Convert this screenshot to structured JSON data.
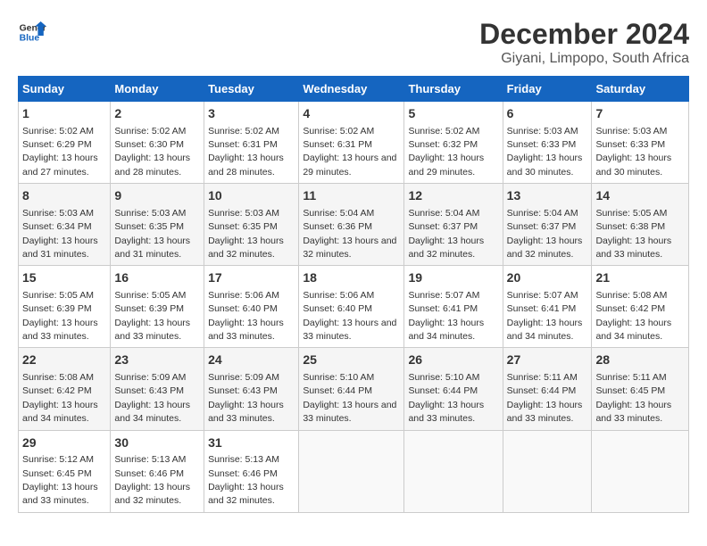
{
  "logo": {
    "line1": "General",
    "line2": "Blue"
  },
  "title": "December 2024",
  "subtitle": "Giyani, Limpopo, South Africa",
  "days_of_week": [
    "Sunday",
    "Monday",
    "Tuesday",
    "Wednesday",
    "Thursday",
    "Friday",
    "Saturday"
  ],
  "weeks": [
    [
      {
        "day": 1,
        "sunrise": "5:02 AM",
        "sunset": "6:29 PM",
        "daylight": "13 hours and 27 minutes."
      },
      {
        "day": 2,
        "sunrise": "5:02 AM",
        "sunset": "6:30 PM",
        "daylight": "13 hours and 28 minutes."
      },
      {
        "day": 3,
        "sunrise": "5:02 AM",
        "sunset": "6:31 PM",
        "daylight": "13 hours and 28 minutes."
      },
      {
        "day": 4,
        "sunrise": "5:02 AM",
        "sunset": "6:31 PM",
        "daylight": "13 hours and 29 minutes."
      },
      {
        "day": 5,
        "sunrise": "5:02 AM",
        "sunset": "6:32 PM",
        "daylight": "13 hours and 29 minutes."
      },
      {
        "day": 6,
        "sunrise": "5:03 AM",
        "sunset": "6:33 PM",
        "daylight": "13 hours and 30 minutes."
      },
      {
        "day": 7,
        "sunrise": "5:03 AM",
        "sunset": "6:33 PM",
        "daylight": "13 hours and 30 minutes."
      }
    ],
    [
      {
        "day": 8,
        "sunrise": "5:03 AM",
        "sunset": "6:34 PM",
        "daylight": "13 hours and 31 minutes."
      },
      {
        "day": 9,
        "sunrise": "5:03 AM",
        "sunset": "6:35 PM",
        "daylight": "13 hours and 31 minutes."
      },
      {
        "day": 10,
        "sunrise": "5:03 AM",
        "sunset": "6:35 PM",
        "daylight": "13 hours and 32 minutes."
      },
      {
        "day": 11,
        "sunrise": "5:04 AM",
        "sunset": "6:36 PM",
        "daylight": "13 hours and 32 minutes."
      },
      {
        "day": 12,
        "sunrise": "5:04 AM",
        "sunset": "6:37 PM",
        "daylight": "13 hours and 32 minutes."
      },
      {
        "day": 13,
        "sunrise": "5:04 AM",
        "sunset": "6:37 PM",
        "daylight": "13 hours and 32 minutes."
      },
      {
        "day": 14,
        "sunrise": "5:05 AM",
        "sunset": "6:38 PM",
        "daylight": "13 hours and 33 minutes."
      }
    ],
    [
      {
        "day": 15,
        "sunrise": "5:05 AM",
        "sunset": "6:39 PM",
        "daylight": "13 hours and 33 minutes."
      },
      {
        "day": 16,
        "sunrise": "5:05 AM",
        "sunset": "6:39 PM",
        "daylight": "13 hours and 33 minutes."
      },
      {
        "day": 17,
        "sunrise": "5:06 AM",
        "sunset": "6:40 PM",
        "daylight": "13 hours and 33 minutes."
      },
      {
        "day": 18,
        "sunrise": "5:06 AM",
        "sunset": "6:40 PM",
        "daylight": "13 hours and 33 minutes."
      },
      {
        "day": 19,
        "sunrise": "5:07 AM",
        "sunset": "6:41 PM",
        "daylight": "13 hours and 34 minutes."
      },
      {
        "day": 20,
        "sunrise": "5:07 AM",
        "sunset": "6:41 PM",
        "daylight": "13 hours and 34 minutes."
      },
      {
        "day": 21,
        "sunrise": "5:08 AM",
        "sunset": "6:42 PM",
        "daylight": "13 hours and 34 minutes."
      }
    ],
    [
      {
        "day": 22,
        "sunrise": "5:08 AM",
        "sunset": "6:42 PM",
        "daylight": "13 hours and 34 minutes."
      },
      {
        "day": 23,
        "sunrise": "5:09 AM",
        "sunset": "6:43 PM",
        "daylight": "13 hours and 34 minutes."
      },
      {
        "day": 24,
        "sunrise": "5:09 AM",
        "sunset": "6:43 PM",
        "daylight": "13 hours and 33 minutes."
      },
      {
        "day": 25,
        "sunrise": "5:10 AM",
        "sunset": "6:44 PM",
        "daylight": "13 hours and 33 minutes."
      },
      {
        "day": 26,
        "sunrise": "5:10 AM",
        "sunset": "6:44 PM",
        "daylight": "13 hours and 33 minutes."
      },
      {
        "day": 27,
        "sunrise": "5:11 AM",
        "sunset": "6:44 PM",
        "daylight": "13 hours and 33 minutes."
      },
      {
        "day": 28,
        "sunrise": "5:11 AM",
        "sunset": "6:45 PM",
        "daylight": "13 hours and 33 minutes."
      }
    ],
    [
      {
        "day": 29,
        "sunrise": "5:12 AM",
        "sunset": "6:45 PM",
        "daylight": "13 hours and 33 minutes."
      },
      {
        "day": 30,
        "sunrise": "5:13 AM",
        "sunset": "6:46 PM",
        "daylight": "13 hours and 32 minutes."
      },
      {
        "day": 31,
        "sunrise": "5:13 AM",
        "sunset": "6:46 PM",
        "daylight": "13 hours and 32 minutes."
      },
      null,
      null,
      null,
      null
    ]
  ]
}
